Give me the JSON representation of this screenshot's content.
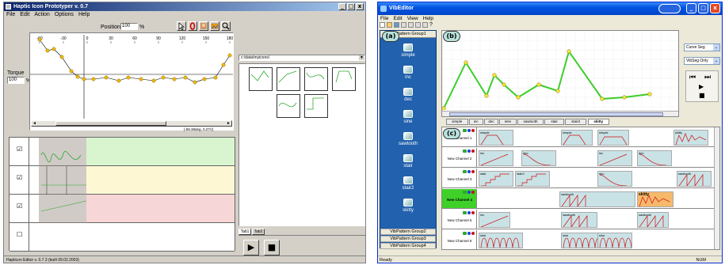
{
  "left": {
    "title": "Haptic Icon Prototyper v. 0.7",
    "menu": [
      "File",
      "Edit",
      "Action",
      "Options",
      "Help"
    ],
    "window_buttons": [
      "_",
      "□",
      "x"
    ],
    "position_label": "Position",
    "position_value": "100",
    "position_unit": "%",
    "torque_label": "Torque",
    "torque_value": "100",
    "torque_unit": "%",
    "x_ticks": [
      "-60",
      "-30",
      "0",
      "30",
      "60",
      "90",
      "120",
      "150",
      "180"
    ],
    "coord_readout": "[-59.38deg, 0.27V]",
    "path_value": "c:\\data\\myicons\\",
    "tabs": [
      "Tab1",
      "Tab2"
    ],
    "status": "Hapticon Editor v. 0.7.3 (built 09.02.2003)",
    "rows": [
      {
        "checked": true,
        "color": "#d9f5d0"
      },
      {
        "checked": true,
        "color": "#fdf8d3"
      },
      {
        "checked": true,
        "color": "#f6d6d6"
      },
      {
        "checked": false,
        "color": "#ffffff"
      }
    ],
    "checkbox_checked_glyph": "☑",
    "checkbox_unchecked_glyph": "☐",
    "play_glyph": "▶",
    "stop_glyph": "■"
  },
  "right": {
    "title": "VibEditor",
    "menu": [
      "File",
      "Edit",
      "View",
      "Help"
    ],
    "annotations": {
      "a": "(a)",
      "b": "(b)",
      "c": "(c)"
    },
    "pattern_group_header": "VibPattern Group1",
    "patterns": [
      "simple",
      "inc",
      "dec",
      "sine",
      "sawtooth",
      "stair",
      "stair2",
      "skitty"
    ],
    "groups_bottom": [
      "VibPattern Group2",
      "VibPattern Group3",
      "VibPattern Group4"
    ],
    "dropdown1": "Curve Seg",
    "dropdown2": "VibSeg Only",
    "transport": {
      "rewind": "⏮",
      "ffwd": "⏭",
      "play": "▶",
      "stop": "■"
    },
    "tabs": [
      "simple",
      "inc",
      "dec",
      "sine",
      "sawtooth",
      "stair",
      "stair2",
      "skitty"
    ],
    "active_tab": "skitty",
    "channels": [
      {
        "name": "New Channel 1",
        "clips": [
          "simple",
          "simple",
          "simple",
          "skitty"
        ]
      },
      {
        "name": "New Channel 2",
        "clips": [
          "inc",
          "dec",
          "inc",
          "dec"
        ]
      },
      {
        "name": "New Channel 3",
        "clips": [
          "stair",
          "stair2",
          "dec",
          "sawtooth"
        ]
      },
      {
        "name": "New Channel 4",
        "clips": [
          "sawtooth",
          "skitty"
        ]
      },
      {
        "name": "New Channel 5",
        "clips": [
          "inc",
          "sawtooth",
          "sawtooth"
        ]
      },
      {
        "name": "New Channel 6",
        "clips": [
          "sine",
          "sine",
          "sine"
        ]
      }
    ],
    "status_left": "Ready",
    "status_right": "NUM"
  }
}
